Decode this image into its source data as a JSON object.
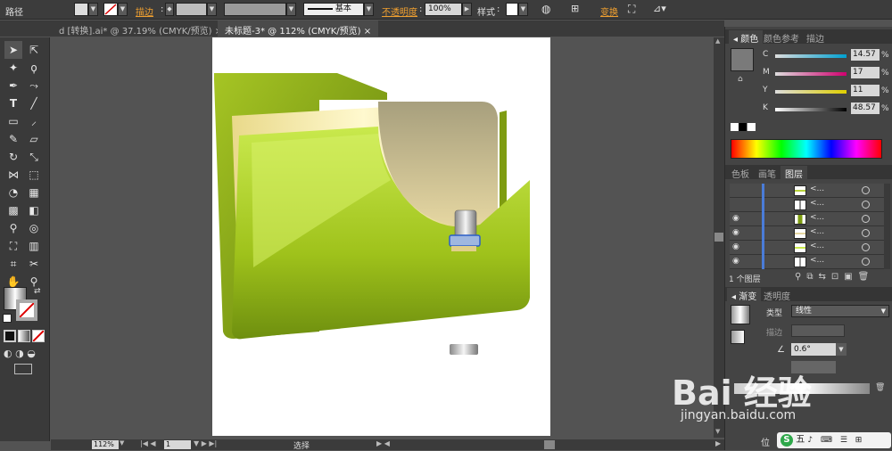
{
  "control_bar": {
    "label_path": "路径",
    "stroke_label": "描边",
    "stroke_style": "基本",
    "opacity_label": "不透明度",
    "opacity_value": "100%",
    "style_label": "样式",
    "transform_label": "变换"
  },
  "tabs": [
    {
      "label": "d [转换].ai* @ 37.19% (CMYK/预览)"
    },
    {
      "label": "未标题-3* @ 112% (CMYK/预览)"
    }
  ],
  "color_panel": {
    "tabs": [
      "颜色",
      "颜色参考",
      "描边"
    ],
    "channels": [
      {
        "label": "C",
        "value": "14.57",
        "unit": "%"
      },
      {
        "label": "M",
        "value": "17",
        "unit": "%"
      },
      {
        "label": "Y",
        "value": "11",
        "unit": "%"
      },
      {
        "label": "K",
        "value": "48.57",
        "unit": "%"
      }
    ]
  },
  "layers_panel": {
    "tabs": [
      "色板",
      "画笔",
      "图层"
    ],
    "rows": [
      "<...",
      "<...",
      "<...",
      "<...",
      "<...",
      "<..."
    ],
    "count_label": "1 个图层"
  },
  "gradient_panel": {
    "tabs": [
      "渐变",
      "透明度"
    ],
    "type_label": "类型",
    "type_value": "线性",
    "stroke_label": "描边",
    "angle_value": "0.6°"
  },
  "status_bar": {
    "zoom": "112%",
    "page": "1",
    "tool": "选择"
  },
  "watermark": {
    "brand": "Bai 经验",
    "url": "jingyan.baidu.com"
  },
  "ime": {
    "label": "五"
  },
  "colors": {
    "folder_green": "#9cbc1a",
    "accent_orange": "#f0a030",
    "ui_dark": "#3c3c3c"
  }
}
